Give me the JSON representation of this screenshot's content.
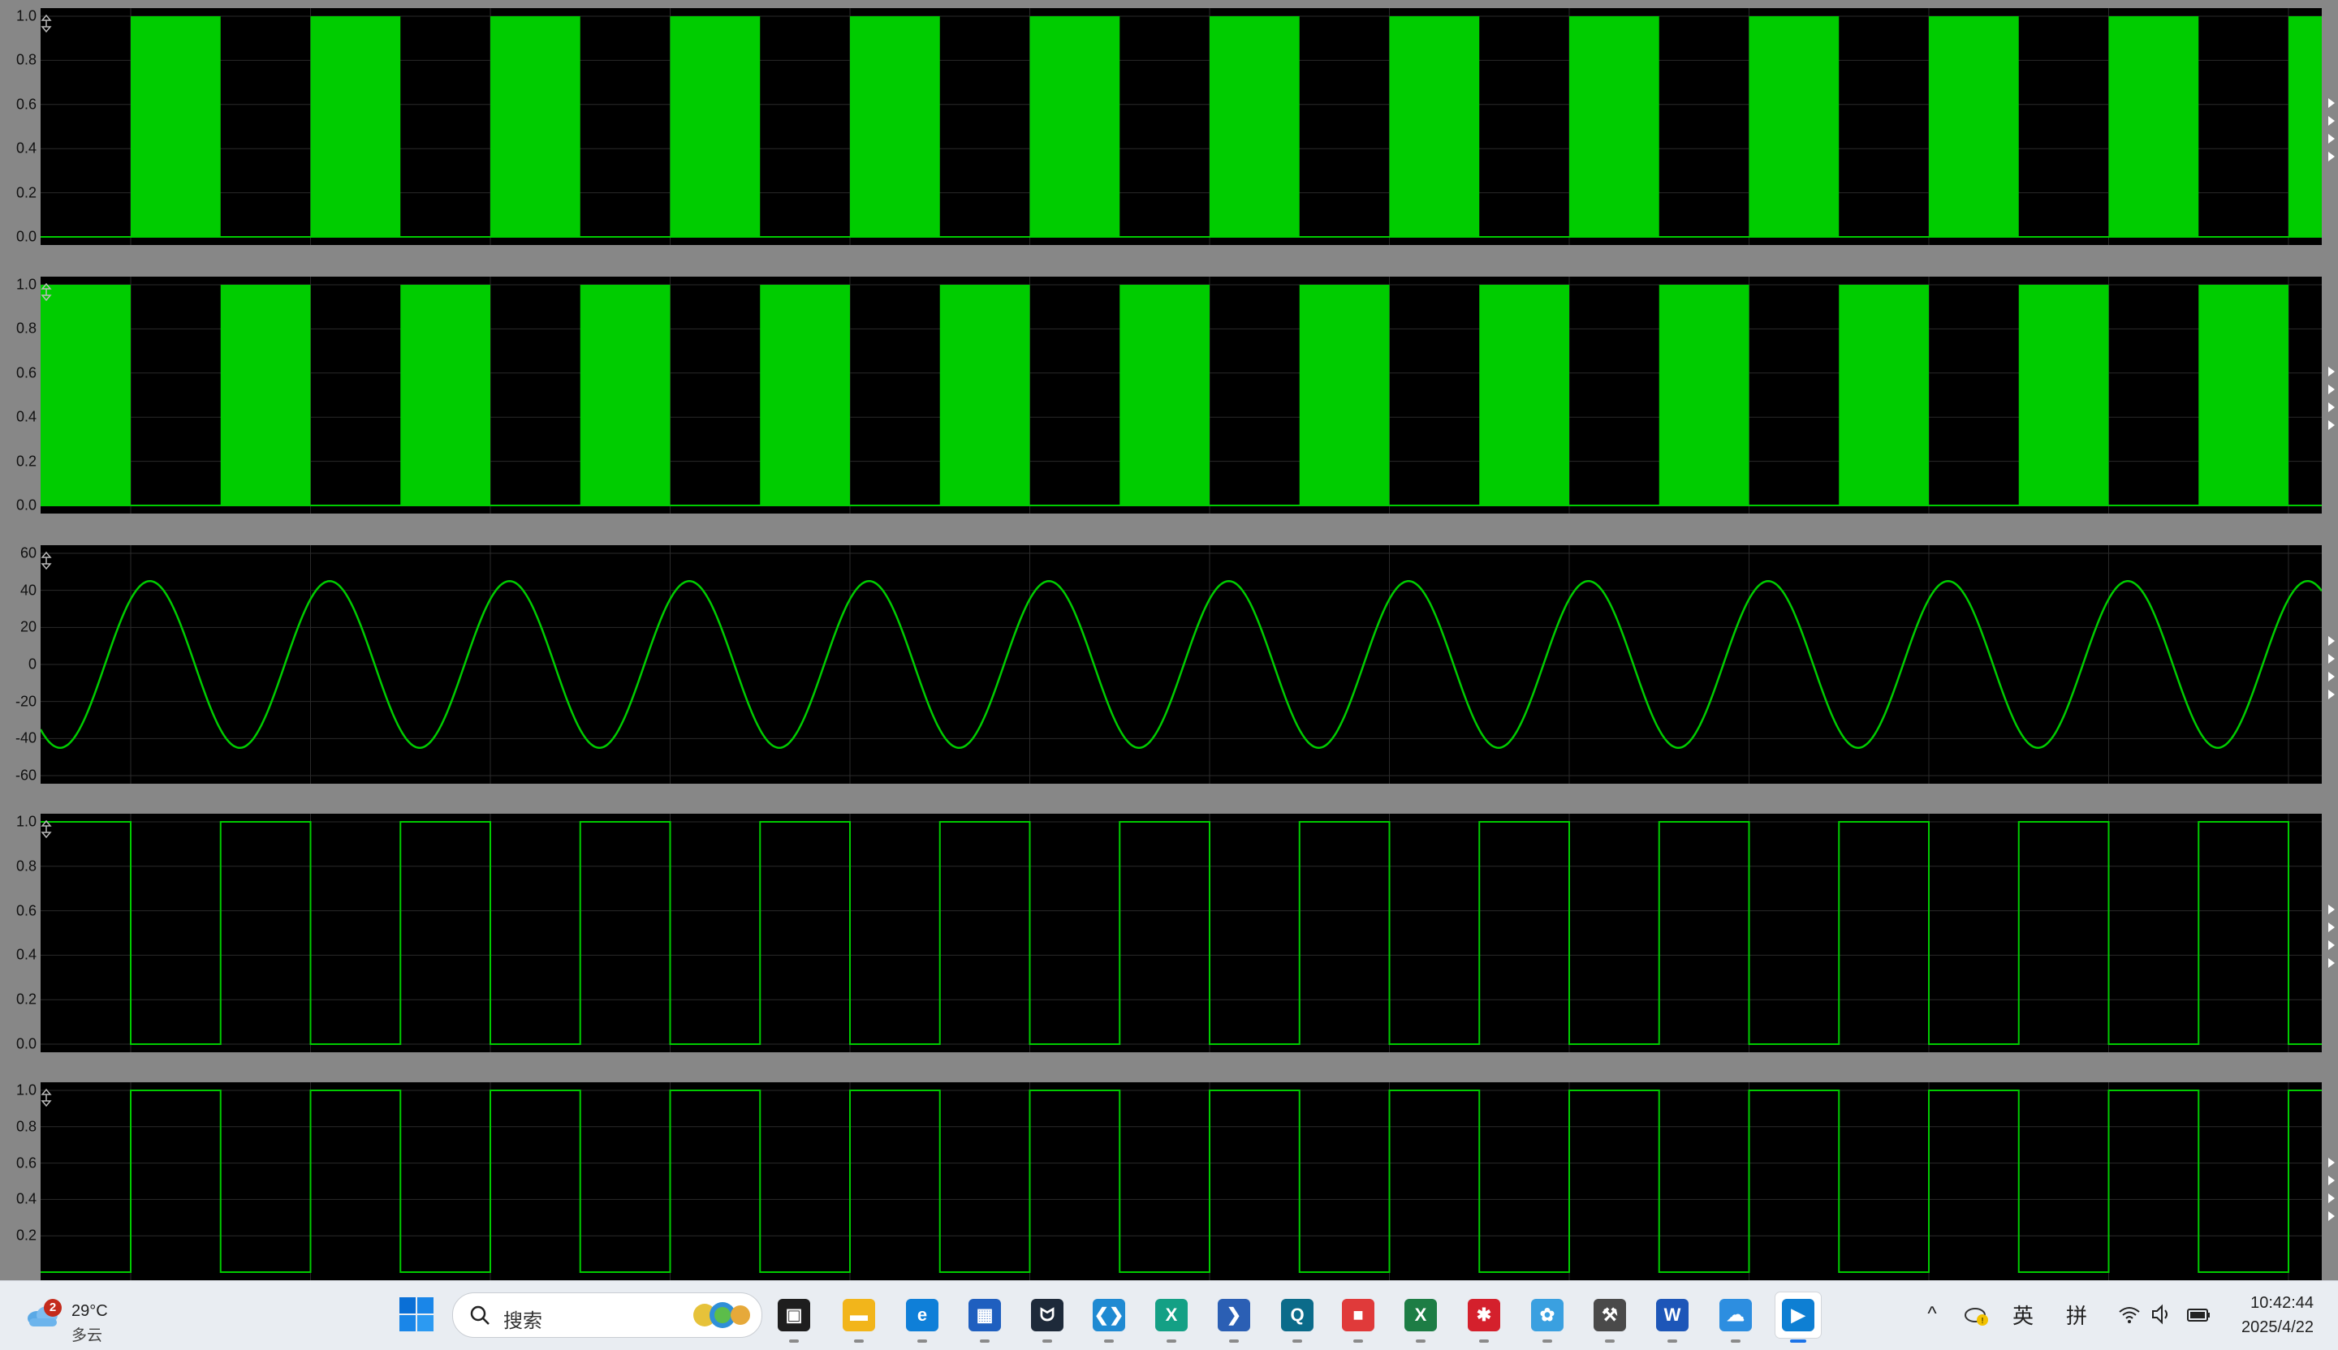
{
  "scope": {
    "background": "#878787",
    "plot_background": "#000000",
    "grid_color": "#2a2a2a",
    "trace_color": "#00cc00",
    "panels": [
      {
        "id": "panel-1",
        "kind": "pwm_fill",
        "yticks": [
          "1.0",
          "0.8",
          "0.6",
          "0.4",
          "0.2",
          "0.0"
        ],
        "ymin": 0,
        "ymax": 1,
        "phase": "low_first"
      },
      {
        "id": "panel-2",
        "kind": "pwm_fill",
        "yticks": [
          "1.0",
          "0.8",
          "0.6",
          "0.4",
          "0.2",
          "0.0"
        ],
        "ymin": 0,
        "ymax": 1,
        "phase": "high_first"
      },
      {
        "id": "panel-3",
        "kind": "sine",
        "yticks": [
          "60",
          "40",
          "20",
          "0",
          "-20",
          "-40",
          "-60"
        ],
        "ymin": -60,
        "ymax": 60,
        "amplitude": 45
      },
      {
        "id": "panel-4",
        "kind": "square",
        "yticks": [
          "1.0",
          "0.8",
          "0.6",
          "0.4",
          "0.2",
          "0.0"
        ],
        "ymin": 0,
        "ymax": 1,
        "phase": "high_first"
      },
      {
        "id": "panel-5",
        "kind": "square",
        "yticks": [
          "1.0",
          "0.8",
          "0.6",
          "0.4",
          "0.2"
        ],
        "ymin": 0,
        "ymax": 1,
        "phase": "low_first"
      }
    ]
  },
  "chart_data": [
    {
      "type": "area",
      "series": [
        {
          "values_description_levels": [
            0,
            1
          ]
        }
      ],
      "ylim": [
        0,
        1
      ],
      "cycles": 13
    },
    {
      "type": "area",
      "ylim": [
        0,
        1
      ],
      "cycles": 13
    },
    {
      "type": "line",
      "ylim": [
        -60,
        60
      ],
      "amplitude": 45,
      "cycles": 13
    },
    {
      "type": "line",
      "ylim": [
        0,
        1
      ],
      "cycles": 13
    },
    {
      "type": "line",
      "ylim": [
        0,
        1
      ],
      "cycles": 13
    }
  ],
  "taskbar": {
    "weather": {
      "badge": "2",
      "temp": "29°C",
      "condition": "多云"
    },
    "search": {
      "placeholder": "搜索"
    },
    "apps": [
      {
        "name": "task-view",
        "label": "",
        "color": "#1e1e1e",
        "glyph": "▣"
      },
      {
        "name": "file-explorer",
        "label": "",
        "color": "#f2b51b",
        "glyph": "▬"
      },
      {
        "name": "edge",
        "label": "",
        "color": "#0f7fd8",
        "glyph": "e"
      },
      {
        "name": "microsoft-store",
        "label": "",
        "color": "#1f5fbf",
        "glyph": "▦"
      },
      {
        "name": "cat-app",
        "label": "",
        "color": "#1e2a3a",
        "glyph": "ᗢ"
      },
      {
        "name": "vscode",
        "label": "",
        "color": "#1f8ad2",
        "glyph": "❮❯"
      },
      {
        "name": "x-app",
        "label": "",
        "color": "#14a085",
        "glyph": "X"
      },
      {
        "name": "powershell",
        "label": "",
        "color": "#2b5fb4",
        "glyph": "❯"
      },
      {
        "name": "q-app",
        "label": "",
        "color": "#0b6b8a",
        "glyph": "Q"
      },
      {
        "name": "red-app",
        "label": "",
        "color": "#e03a3a",
        "glyph": "■"
      },
      {
        "name": "excel",
        "label": "",
        "color": "#1d7d45",
        "glyph": "X"
      },
      {
        "name": "huawei-app",
        "label": "",
        "color": "#d4202c",
        "glyph": "✱"
      },
      {
        "name": "flower-app",
        "label": "",
        "color": "#3aa0e0",
        "glyph": "✿"
      },
      {
        "name": "tools-app",
        "label": "",
        "color": "#4a4a4a",
        "glyph": "⚒"
      },
      {
        "name": "word",
        "label": "",
        "color": "#1d56b8",
        "glyph": "W"
      },
      {
        "name": "cloud-app",
        "label": "",
        "color": "#2d8ee0",
        "glyph": "☁"
      },
      {
        "name": "active-app",
        "label": "",
        "color": "#0e7fd3",
        "glyph": "▶",
        "active": true
      }
    ],
    "tray": {
      "chevron": "^",
      "ime_lang": "英",
      "ime_mode": "拼"
    },
    "clock": {
      "time": "10:42:44",
      "date": "2025/4/22"
    }
  }
}
